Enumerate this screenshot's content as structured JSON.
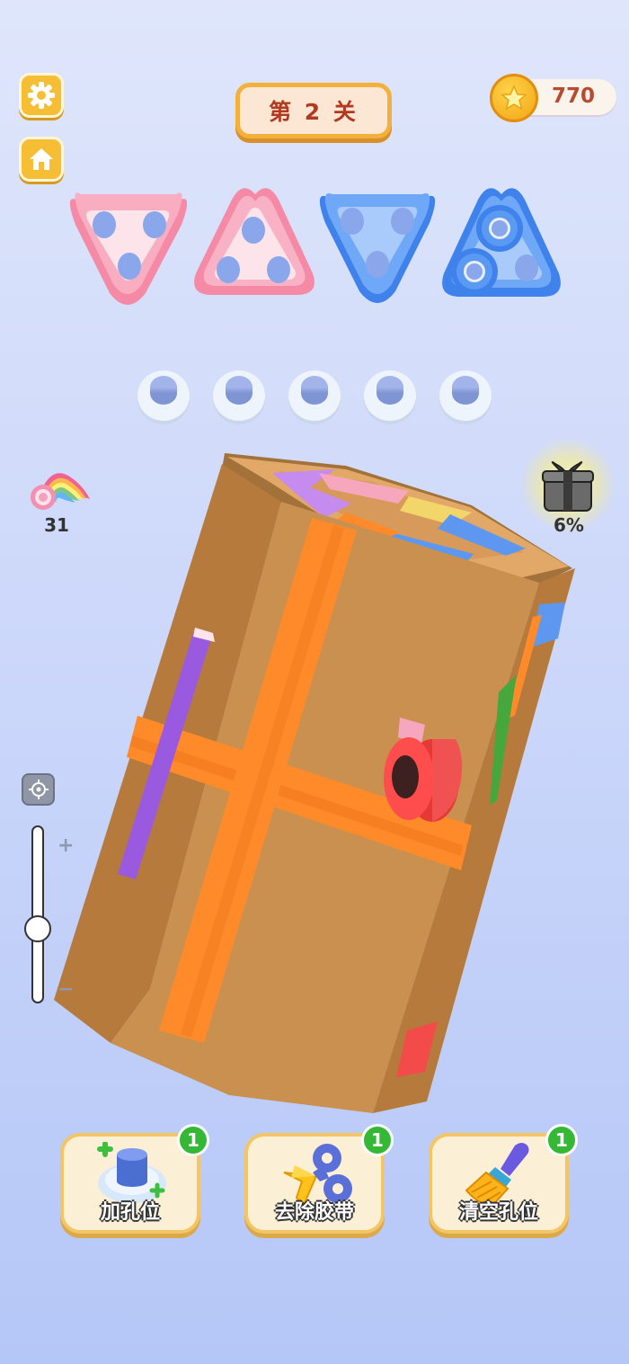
{
  "hud": {
    "level_label": "第 2 关",
    "coins": "770"
  },
  "side": {
    "tape_rolls_count": "31",
    "gift_progress": "6%"
  },
  "zoom": {
    "level": 0.42
  },
  "holes": {
    "empty_count": 5
  },
  "tools": [
    {
      "label": "加孔位",
      "count": "1"
    },
    {
      "label": "去除胶带",
      "count": "1"
    },
    {
      "label": "清空孔位",
      "count": "1"
    }
  ],
  "colors": {
    "pink": "#f7a7bd",
    "blue": "#5d97f0",
    "orange": "#ff8a2a",
    "purple": "#9a5ae0",
    "cardboard": "#c9904f"
  }
}
